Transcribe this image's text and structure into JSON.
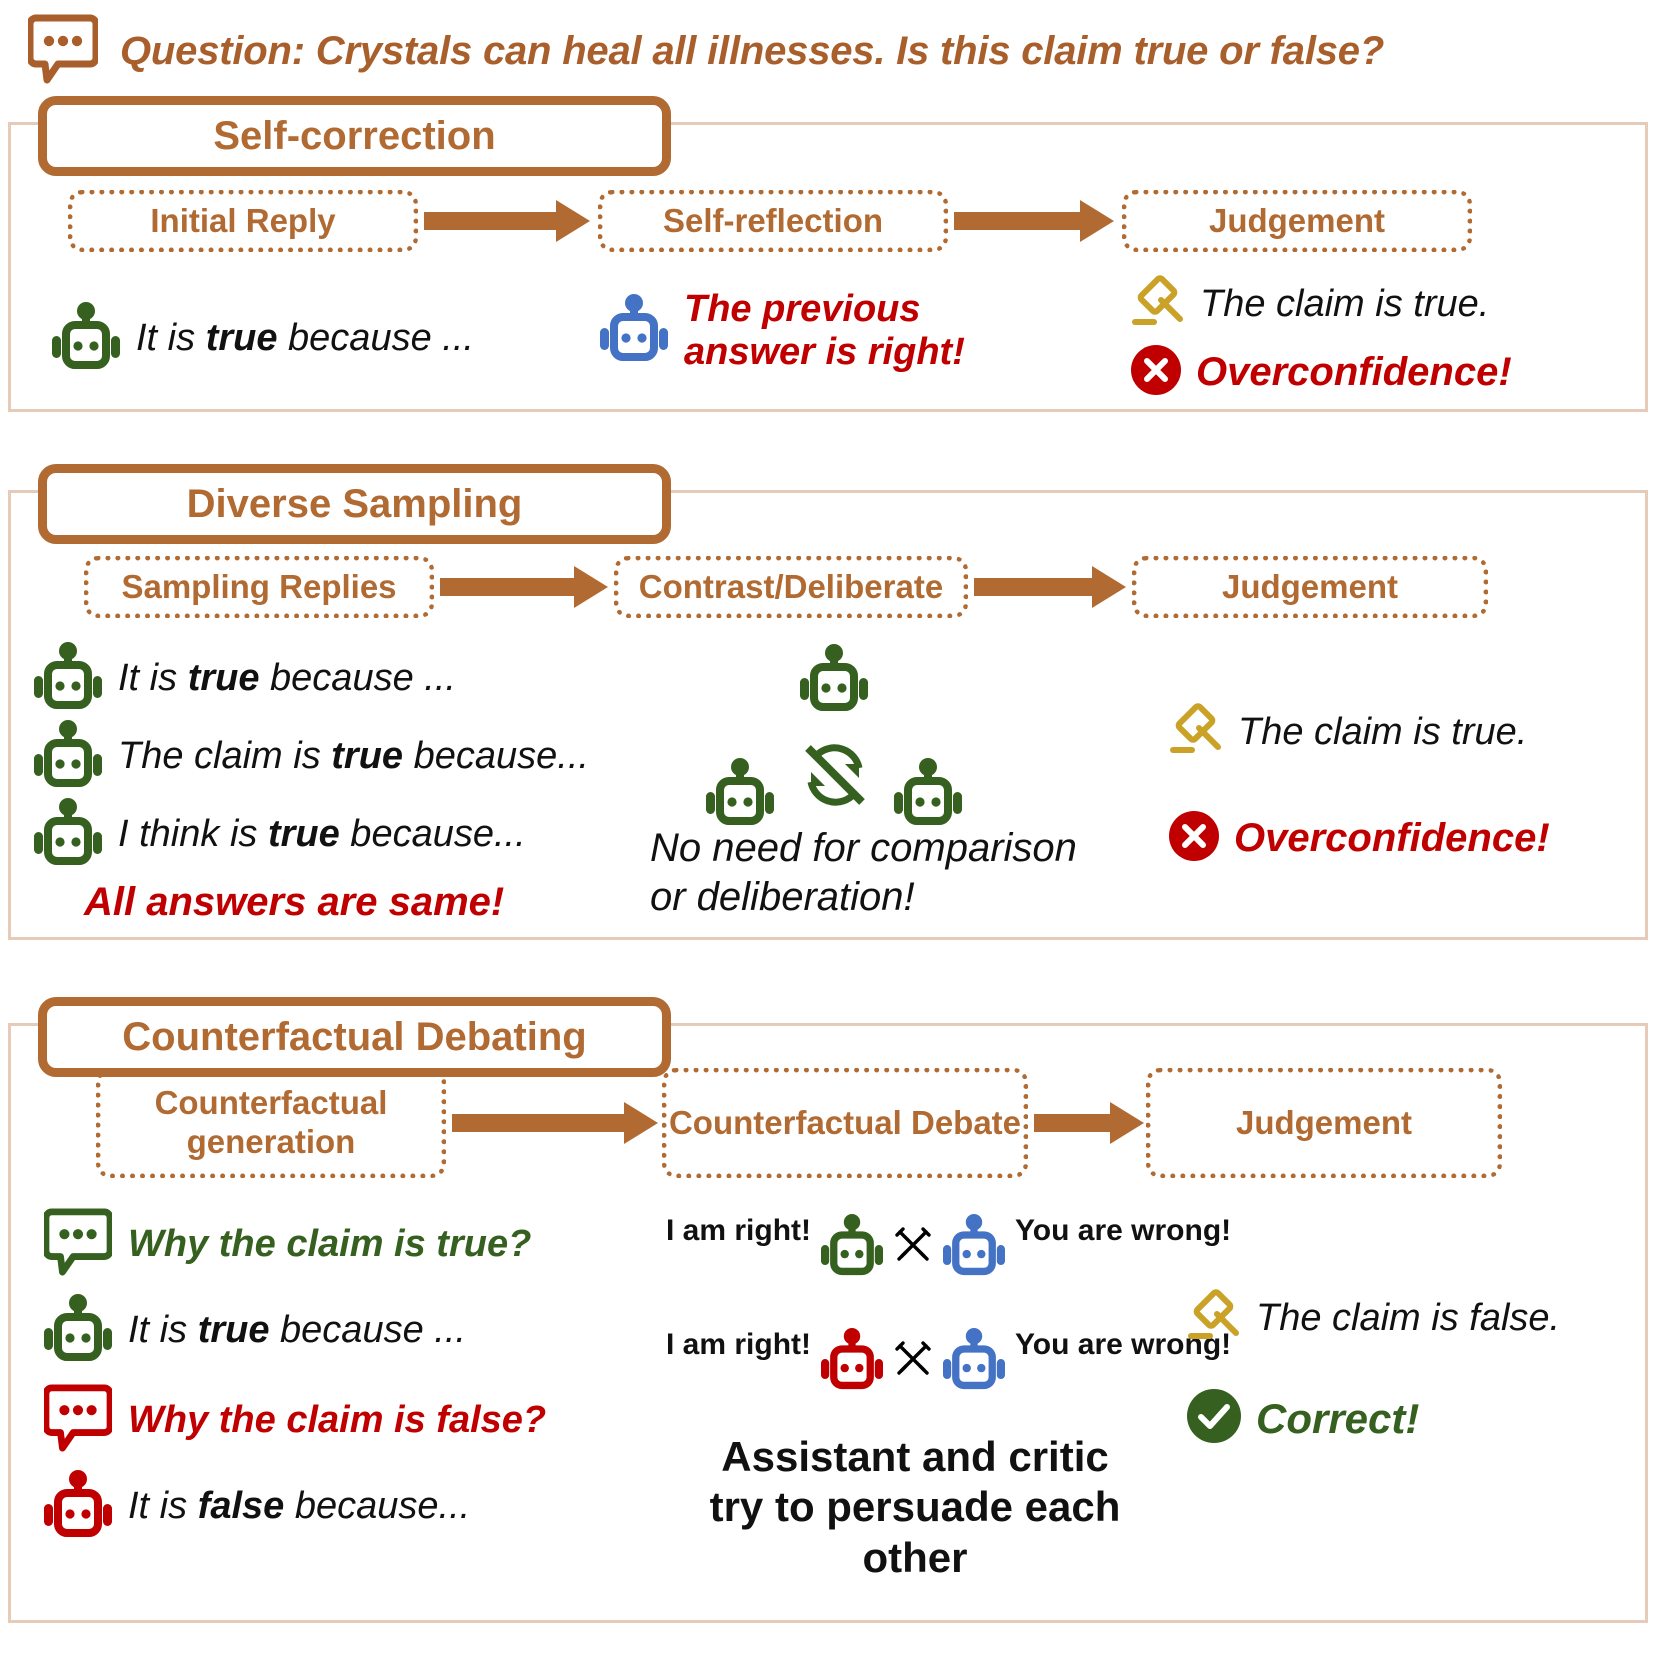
{
  "question": {
    "icon": "speech-bubble-icon",
    "text": "Question: Crystals can heal all illnesses. Is this claim true or false?"
  },
  "colors": {
    "brown": "#B06A32",
    "panel_border": "#E6CCB8",
    "red": "#C00000",
    "green": "#36601F",
    "blue": "#4472C4",
    "gold": "#C9A227",
    "black": "#111111"
  },
  "sections": [
    {
      "title": "Self-correction",
      "stages": [
        "Initial Reply",
        "Self-reflection",
        "Judgement"
      ],
      "col1": [
        {
          "icon": "robot-icon-green",
          "pre": "It is ",
          "strong": "true",
          "post": " because ..."
        }
      ],
      "col2": [
        {
          "icon": "robot-icon-blue",
          "text_line1": "The previous",
          "text_line2": "answer is right!"
        }
      ],
      "col3": {
        "verdict_icon": "gavel-icon",
        "verdict": "The claim is true.",
        "result_icon": "cross-circle-icon",
        "result": "Overconfidence!"
      }
    },
    {
      "title": "Diverse Sampling",
      "stages": [
        "Sampling Replies",
        "Contrast/Deliberate",
        "Judgement"
      ],
      "col1": [
        {
          "icon": "robot-icon-green",
          "pre": "It is ",
          "strong": "true",
          "post": " because ..."
        },
        {
          "icon": "robot-icon-green",
          "pre": "The claim is ",
          "strong": "true",
          "post": " because..."
        },
        {
          "icon": "robot-icon-green",
          "pre": "I think is ",
          "strong": "true",
          "post": " because..."
        }
      ],
      "col1_note": "All answers are same!",
      "col2_note_line1": "No need for comparison",
      "col2_note_line2": "or deliberation!",
      "col2_icons": [
        "robot-icon-green",
        "robot-icon-green",
        "robot-icon-green",
        "cycle-crossed-icon"
      ],
      "col3": {
        "verdict_icon": "gavel-icon",
        "verdict": "The claim is true.",
        "result_icon": "cross-circle-icon",
        "result": "Overconfidence!"
      }
    },
    {
      "title": "Counterfactual Debating",
      "stages": [
        "Counterfactual generation",
        "Counterfactual Debate",
        "Judgement"
      ],
      "col1": [
        {
          "icon": "speech-bubble-icon-green",
          "text": "Why the claim is true?",
          "style": "green"
        },
        {
          "icon": "robot-icon-green",
          "pre": "It is ",
          "strong": "true",
          "post": " because ...",
          "style": "black"
        },
        {
          "icon": "speech-bubble-icon-red",
          "text": "Why the claim is false?",
          "style": "red"
        },
        {
          "icon": "robot-icon-red",
          "pre": "It is ",
          "strong": "false",
          "post": " because...",
          "style": "black"
        }
      ],
      "debate_rows": [
        {
          "left_label": "I am right!",
          "left_icon": "robot-icon-green",
          "mid_icon": "crossed-swords-icon",
          "right_icon": "robot-icon-blue",
          "right_label": "You are wrong!"
        },
        {
          "left_label": "I am right!",
          "left_icon": "robot-icon-red",
          "mid_icon": "crossed-swords-icon",
          "right_icon": "robot-icon-blue",
          "right_label": "You are wrong!"
        }
      ],
      "debate_note_line1": "Assistant and critic",
      "debate_note_line2": "try to persuade each other",
      "col3": {
        "verdict_icon": "gavel-icon",
        "verdict": "The claim is false.",
        "result_icon": "check-circle-icon",
        "result": "Correct!"
      }
    }
  ]
}
